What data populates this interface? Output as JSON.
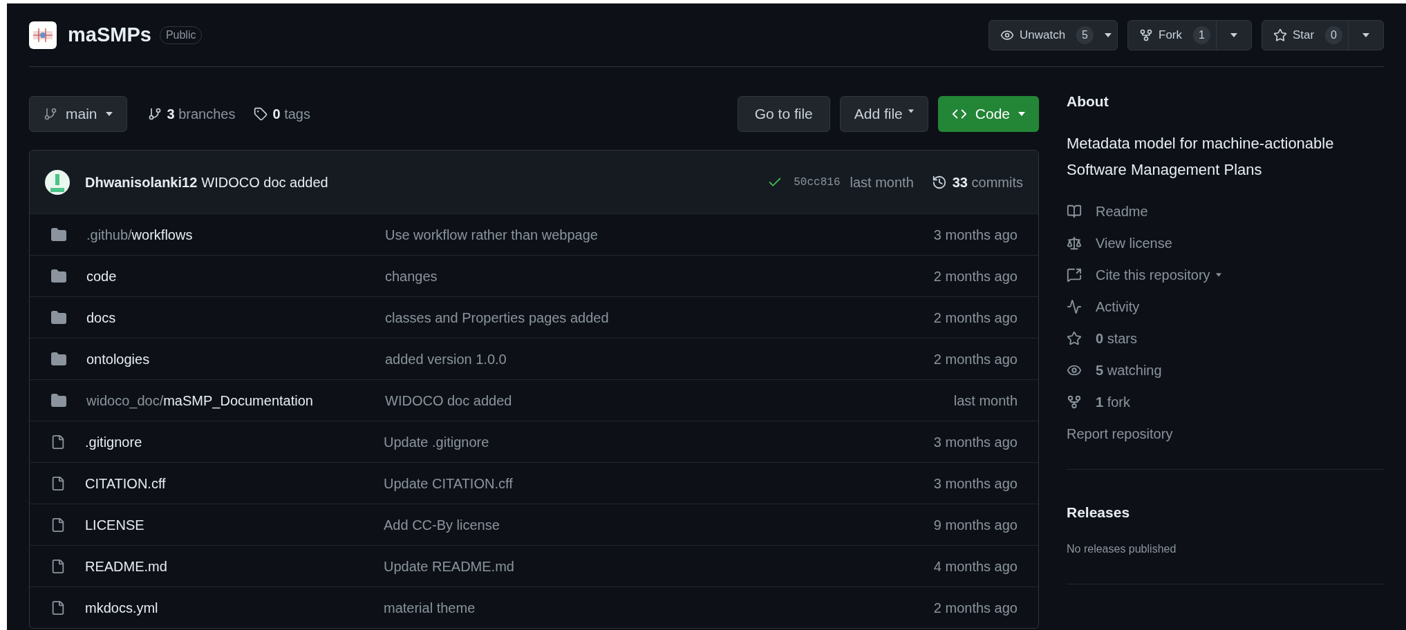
{
  "repo": {
    "name": "maSMPs",
    "visibility": "Public"
  },
  "header_actions": [
    {
      "kind": "watch",
      "label": "Unwatch",
      "count": "5"
    },
    {
      "kind": "fork",
      "label": "Fork",
      "count": "1"
    },
    {
      "kind": "star",
      "label": "Star",
      "count": "0"
    }
  ],
  "branch": {
    "name": "main",
    "branches": "**3** branches",
    "tags": "**0** tags"
  },
  "buttons": [
    {
      "kind": "plain",
      "label": "Go to file"
    },
    {
      "kind": "menu",
      "label": "Add file"
    },
    {
      "kind": "primary",
      "label": "Code"
    }
  ],
  "last_commit": {
    "author": "Dhwanisolanki12",
    "message": "WIDOCO doc added",
    "sha": "50cc816",
    "time": "last month",
    "commits": "**33** commits"
  },
  "files": [
    {
      "kind": "folder",
      "prefix": ".github/",
      "name": "workflows",
      "message": "Use workflow rather than webpage",
      "time": "3 months ago"
    },
    {
      "kind": "folder",
      "name": "code",
      "message": "changes",
      "time": "2 months ago"
    },
    {
      "kind": "folder",
      "name": "docs",
      "message": "classes and Properties pages added",
      "time": "2 months ago"
    },
    {
      "kind": "folder",
      "name": "ontologies",
      "message": "added version 1.0.0",
      "time": "2 months ago"
    },
    {
      "kind": "folder",
      "prefix": "widoco_doc/",
      "name": "maSMP_Documentation",
      "message": "WIDOCO doc added",
      "time": "last month"
    },
    {
      "kind": "file",
      "name": ".gitignore",
      "message": "Update .gitignore",
      "time": "3 months ago"
    },
    {
      "kind": "file",
      "name": "CITATION.cff",
      "message": "Update CITATION.cff",
      "time": "3 months ago"
    },
    {
      "kind": "file",
      "name": "LICENSE",
      "message": "Add CC-By license",
      "time": "9 months ago"
    },
    {
      "kind": "file",
      "name": "README.md",
      "message": "Update README.md",
      "time": "4 months ago"
    },
    {
      "kind": "file",
      "name": "mkdocs.yml",
      "message": "material theme",
      "time": "2 months ago"
    }
  ],
  "about": {
    "title": "About",
    "description": "Metadata model for machine-actionable Software Management Plans",
    "links": [
      {
        "kind": "book",
        "text": "Readme"
      },
      {
        "kind": "scale",
        "text": "View license"
      },
      {
        "kind": "cite",
        "text": "Cite this repository",
        "menu": true
      },
      {
        "kind": "activity",
        "text": "Activity"
      },
      {
        "kind": "star",
        "text": "**0** stars"
      },
      {
        "kind": "eye",
        "text": "**5** watching"
      },
      {
        "kind": "fork",
        "text": "**1** fork"
      }
    ],
    "report": "Report repository"
  },
  "releases": {
    "title": "Releases",
    "note": "No releases published"
  }
}
